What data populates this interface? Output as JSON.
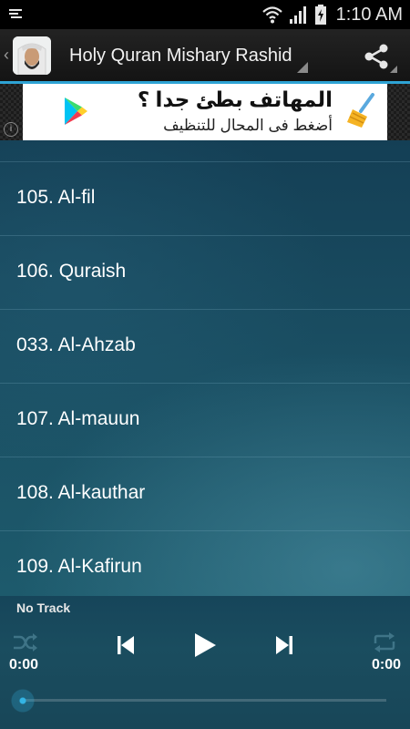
{
  "status_bar": {
    "time": "1:10 AM"
  },
  "action_bar": {
    "title": "Holy Quran Mishary Rashid"
  },
  "ad": {
    "headline": "المهاتف بطئ جدا ؟",
    "subtext": "أضغط فى المحال للتنظيف",
    "info_glyph": "i"
  },
  "tracks": [
    {
      "label": "105. Al-fil"
    },
    {
      "label": "106. Quraish"
    },
    {
      "label": "033. Al-Ahzab"
    },
    {
      "label": "107. Al-mauun"
    },
    {
      "label": "108. Al-kauthar"
    },
    {
      "label": "109. Al-Kafirun"
    }
  ],
  "player": {
    "track_title": "No Track",
    "elapsed": "0:00",
    "duration": "0:00",
    "progress": 0
  },
  "colors": {
    "accent": "#2ea3d4",
    "list_background": "#1a4f63",
    "action_bar": "#1c1c1c"
  },
  "icons": {
    "status_left": "notification-icon",
    "wifi": "wifi-icon",
    "signal": "signal-icon",
    "battery": "battery-charging-icon",
    "share": "share-icon",
    "ad_play": "play-store-icon",
    "ad_broom": "broom-icon",
    "shuffle": "shuffle-icon",
    "previous": "previous-icon",
    "play": "play-icon",
    "next": "next-icon",
    "repeat": "repeat-icon"
  }
}
